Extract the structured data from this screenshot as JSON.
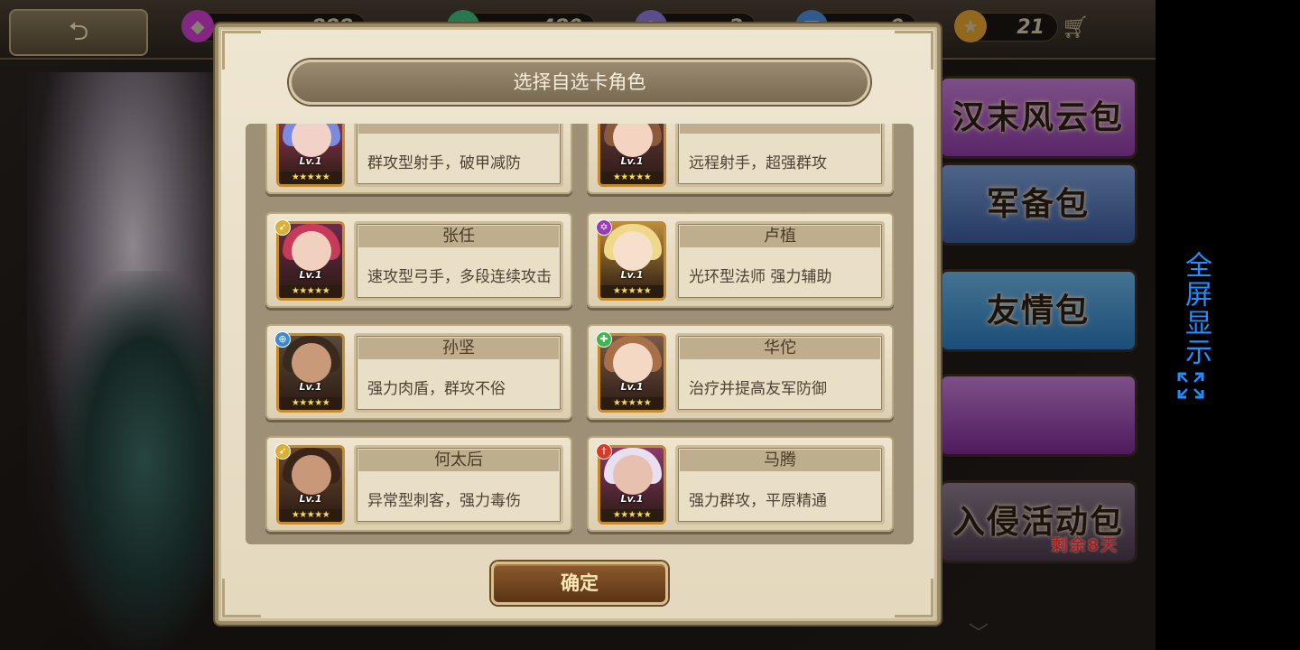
{
  "topbar": {
    "back_icon": "back-arrow-icon",
    "resources": [
      {
        "icon": "gem-icon",
        "value": "888",
        "color": "#c83cc8"
      },
      {
        "icon": "stamina-icon",
        "value": "480",
        "color": "#3cb878"
      },
      {
        "icon": "gold-icon",
        "value": "2",
        "color": "#8a78d8"
      },
      {
        "icon": "ticket-icon",
        "value": "0",
        "color": "#4a8ad8"
      },
      {
        "icon": "star-icon",
        "value": "21",
        "color": "#e0a030"
      }
    ],
    "shop_icon": "cart-icon"
  },
  "packs": [
    {
      "label": "汉末风云包",
      "color": "#a04ab8"
    },
    {
      "label": "军备包",
      "color": "#4a78b8"
    },
    {
      "label": "友情包",
      "color": "#3a8cc8"
    },
    {
      "label": "",
      "color": "#a04ab8"
    },
    {
      "label": "入侵活动包",
      "badge": "剩余8天",
      "color": "#6a4a7a"
    }
  ],
  "fullscreen": {
    "label": "全屏显示",
    "icon": "expand-icon"
  },
  "dialog": {
    "title": "选择自选卡角色",
    "confirm": "确定",
    "cards": [
      {
        "name": "",
        "desc": "群攻型射手，破甲减防",
        "level": "Lv.1",
        "stars": "★★★★★",
        "class_icon": "",
        "hair": "#7a8ce0",
        "face": "#f2d2c8",
        "bg": "#9a3a5a"
      },
      {
        "name": "",
        "desc": "远程射手，超强群攻",
        "level": "Lv.1",
        "stars": "★★★★★",
        "class_icon": "",
        "hair": "#8a5a3a",
        "face": "#f4d4c0",
        "bg": "#6a3a40"
      },
      {
        "name": "张任",
        "desc": "速攻型弓手，多段连续攻击",
        "level": "Lv.1",
        "stars": "★★★★★",
        "class_icon": "bow-class-icon",
        "class_color": "#d8b038",
        "hair": "#c83a5a",
        "face": "#f2d0c0",
        "bg": "#6a2a4a"
      },
      {
        "name": "卢植",
        "desc": "光环型法师 强力辅助",
        "level": "Lv.1",
        "stars": "★★★★★",
        "class_icon": "mage-class-icon",
        "class_color": "#9a3ab8",
        "hair": "#f0d88a",
        "face": "#f6e0cc",
        "bg": "#b88a3a"
      },
      {
        "name": "孙坚",
        "desc": "强力肉盾，群攻不俗",
        "level": "Lv.1",
        "stars": "★★★★★",
        "class_icon": "shield-class-icon",
        "class_color": "#3a8ad8",
        "hair": "#3a2a1e",
        "face": "#c89a7a",
        "bg": "#5a4a3a"
      },
      {
        "name": "华佗",
        "desc": "治疗并提高友军防御",
        "level": "Lv.1",
        "stars": "★★★★★",
        "class_icon": "healer-class-icon",
        "class_color": "#3ab84a",
        "hair": "#a87048",
        "face": "#f4d8c4",
        "bg": "#7a5a4a"
      },
      {
        "name": "何太后",
        "desc": "异常型刺客，强力毒伤",
        "level": "Lv.1",
        "stars": "★★★★★",
        "class_icon": "bow-class-icon",
        "class_color": "#d8b038",
        "hair": "#3a2418",
        "face": "#c89878",
        "bg": "#6a4a30"
      },
      {
        "name": "马腾",
        "desc": "强力群攻，平原精通",
        "level": "Lv.1",
        "stars": "★★★★★",
        "class_icon": "sword-class-icon",
        "class_color": "#d83a2a",
        "hair": "#e8e0f0",
        "face": "#e8c0b0",
        "bg": "#8a3a6a"
      }
    ]
  }
}
